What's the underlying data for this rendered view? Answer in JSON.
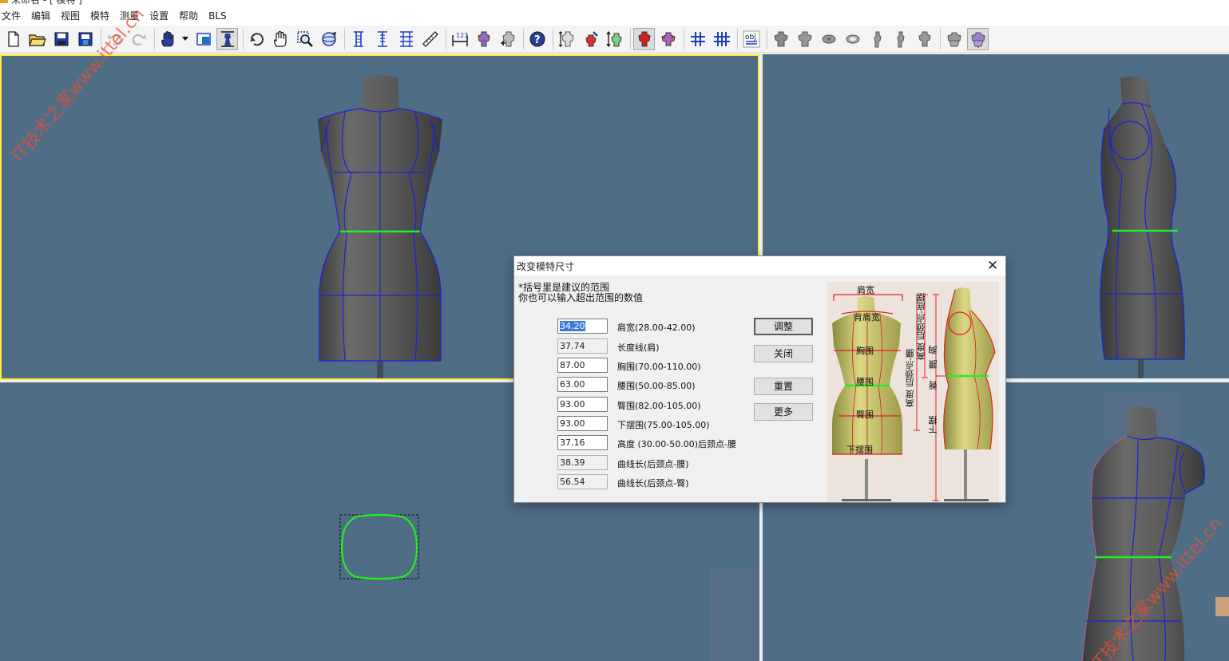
{
  "window": {
    "title": "未命名 - [ 模特 ]"
  },
  "menu": [
    {
      "name": "menu-file",
      "label": "文件"
    },
    {
      "name": "menu-edit",
      "label": "编辑"
    },
    {
      "name": "menu-view",
      "label": "视图"
    },
    {
      "name": "menu-model",
      "label": "模特"
    },
    {
      "name": "menu-measure",
      "label": "测量"
    },
    {
      "name": "menu-settings",
      "label": "设置"
    },
    {
      "name": "menu-help",
      "label": "帮助"
    },
    {
      "name": "menu-bls",
      "label": "BLS"
    }
  ],
  "toolbar": {
    "icons": [
      "new-file-icon",
      "open-folder-icon",
      "save-icon",
      "save-as-icon",
      "undo-icon",
      "redo-icon",
      "hand-dropdown-icon",
      "viewport-layout-icon",
      "fit-view-icon",
      "rotate-icon",
      "pan-hand-icon",
      "zoom-region-icon",
      "orbit-icon",
      "measure-vertical-icon",
      "measure-spacing-icon",
      "measure-grid-icon",
      "ruler-icon",
      "number-123-icon",
      "model-points-icon",
      "model-add-icon",
      "help-icon",
      "model-height-icon",
      "model-paint-icon",
      "model-stretch-icon",
      "model-red-icon",
      "model-purple-icon",
      "grid-small-icon",
      "grid-large-icon",
      "obj-export-icon",
      "torso-1-icon",
      "torso-2-icon",
      "torso-3-icon",
      "torso-4-icon",
      "torso-5-icon",
      "torso-6-icon",
      "torso-7-icon",
      "torso-8-icon",
      "torso-active-icon"
    ]
  },
  "watermark": {
    "text": "IT技术之家www.ittel.cn"
  },
  "dialog": {
    "title": "改变模特尺寸",
    "hint_line1": "*括号里是建议的范围",
    "hint_line2": "你也可以输入超出范围的数值",
    "fields": [
      {
        "value": "34.20",
        "label": "肩宽(28.00-42.00)",
        "readonly": false,
        "selected": true
      },
      {
        "value": "37.74",
        "label": "长度线(肩)",
        "readonly": true,
        "selected": false
      },
      {
        "value": "87.00",
        "label": "胸围(70.00-110.00)",
        "readonly": false,
        "selected": false
      },
      {
        "value": "63.00",
        "label": "腰围(50.00-85.00)",
        "readonly": false,
        "selected": false
      },
      {
        "value": "93.00",
        "label": "臀围(82.00-105.00)",
        "readonly": false,
        "selected": false
      },
      {
        "value": "93.00",
        "label": "下摆围(75.00-105.00)",
        "readonly": false,
        "selected": false
      },
      {
        "value": "37.16",
        "label": "高度 (30.00-50.00)后颈点-腰",
        "readonly": false,
        "selected": false
      },
      {
        "value": "38.39",
        "label": "曲线长(后颈点-腰)",
        "readonly": true,
        "selected": false
      },
      {
        "value": "56.54",
        "label": "曲线长(后颈点-臀)",
        "readonly": true,
        "selected": false
      }
    ],
    "buttons": {
      "adjust": "调整",
      "close": "关闭",
      "reset": "重置",
      "more": "更多"
    },
    "figure_labels": {
      "shoulder": "肩宽",
      "back_shoulder": "背肩宽",
      "chest": "胸围",
      "waist": "腰围",
      "hip": "臀围",
      "hem": "下摆围",
      "height_neck_waist": "高度 后颈点-腰",
      "height_neck_hem": "高度 后颈点-底摆",
      "chest_side": "胸",
      "waist_side": "腰",
      "hip_side": "臀",
      "hem_side": "下摆"
    }
  },
  "colors": {
    "viewport_bg": "#4f6d85",
    "active_border": "#ffeb3b",
    "mesh_line": "#1a22d8",
    "waist_line": "#22ee22",
    "figure_red": "#e02020"
  }
}
